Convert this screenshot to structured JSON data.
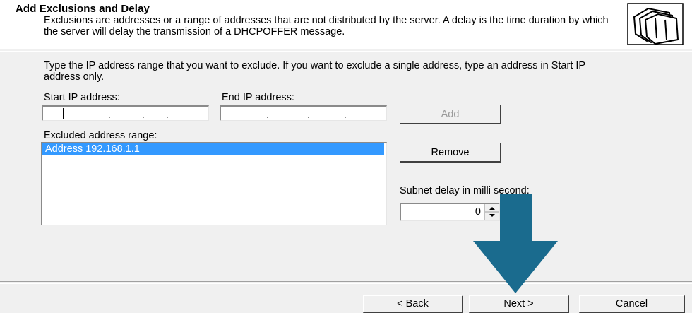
{
  "header": {
    "title": "Add Exclusions and Delay",
    "description": "Exclusions are addresses or a range of addresses that are not distributed by the server. A delay is the time duration by which the server will delay the transmission of a DHCPOFFER message.",
    "icon": "folders-icon"
  },
  "instruction": "Type the IP address range that you want to exclude. If you want to exclude a single address, type an address in Start IP address only.",
  "start_ip": {
    "label": "Start IP address:",
    "value": ""
  },
  "end_ip": {
    "label": "End IP address:",
    "value": ""
  },
  "buttons": {
    "add": "Add",
    "remove": "Remove",
    "back": "< Back",
    "next": "Next >",
    "cancel": "Cancel"
  },
  "excluded": {
    "label": "Excluded address range:",
    "items": [
      "Address 192.168.1.1"
    ]
  },
  "subnet_delay": {
    "label": "Subnet delay in milli second:",
    "value": "0"
  },
  "colors": {
    "selection": "#3399ff",
    "annotation_arrow": "#1a6b8e"
  }
}
